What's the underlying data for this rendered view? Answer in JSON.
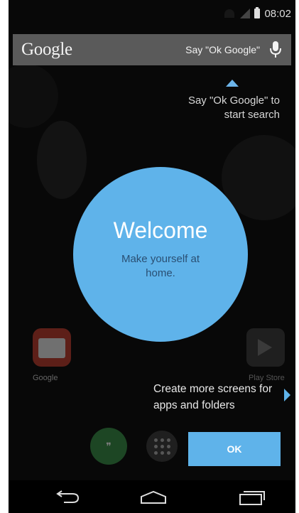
{
  "status_bar": {
    "time": "08:02"
  },
  "search_bar": {
    "logo_text": "Google",
    "hint": "Say \"Ok Google\"",
    "mic_icon": "mic-icon"
  },
  "tooltip": {
    "text_line1": "Say \"Ok Google\" to",
    "text_line2": "start search"
  },
  "welcome": {
    "title": "Welcome",
    "subtitle": "Make yourself at home."
  },
  "apps": {
    "gmail_label": "Google",
    "play_label": "Play Store"
  },
  "screens_hint": {
    "line1": "Create more screens for",
    "line2": "apps and folders"
  },
  "ok_button": {
    "label": "OK"
  },
  "nav": {
    "back_icon": "back-icon",
    "home_icon": "home-icon",
    "recents_icon": "recents-icon"
  },
  "colors": {
    "accent": "#5fb3ea",
    "background": "#080808",
    "search_bar": "#5a5a5a"
  }
}
